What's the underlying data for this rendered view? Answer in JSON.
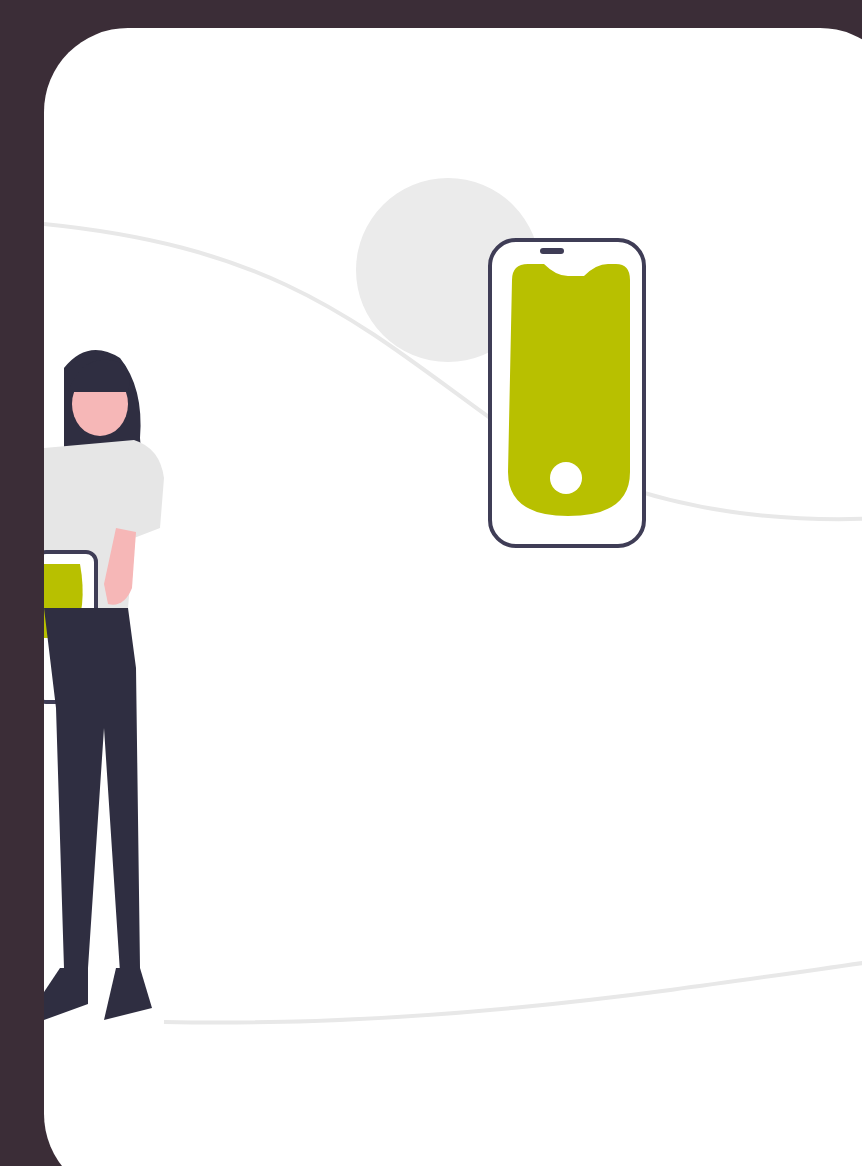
{
  "illustration": {
    "kind": "phone-person"
  }
}
